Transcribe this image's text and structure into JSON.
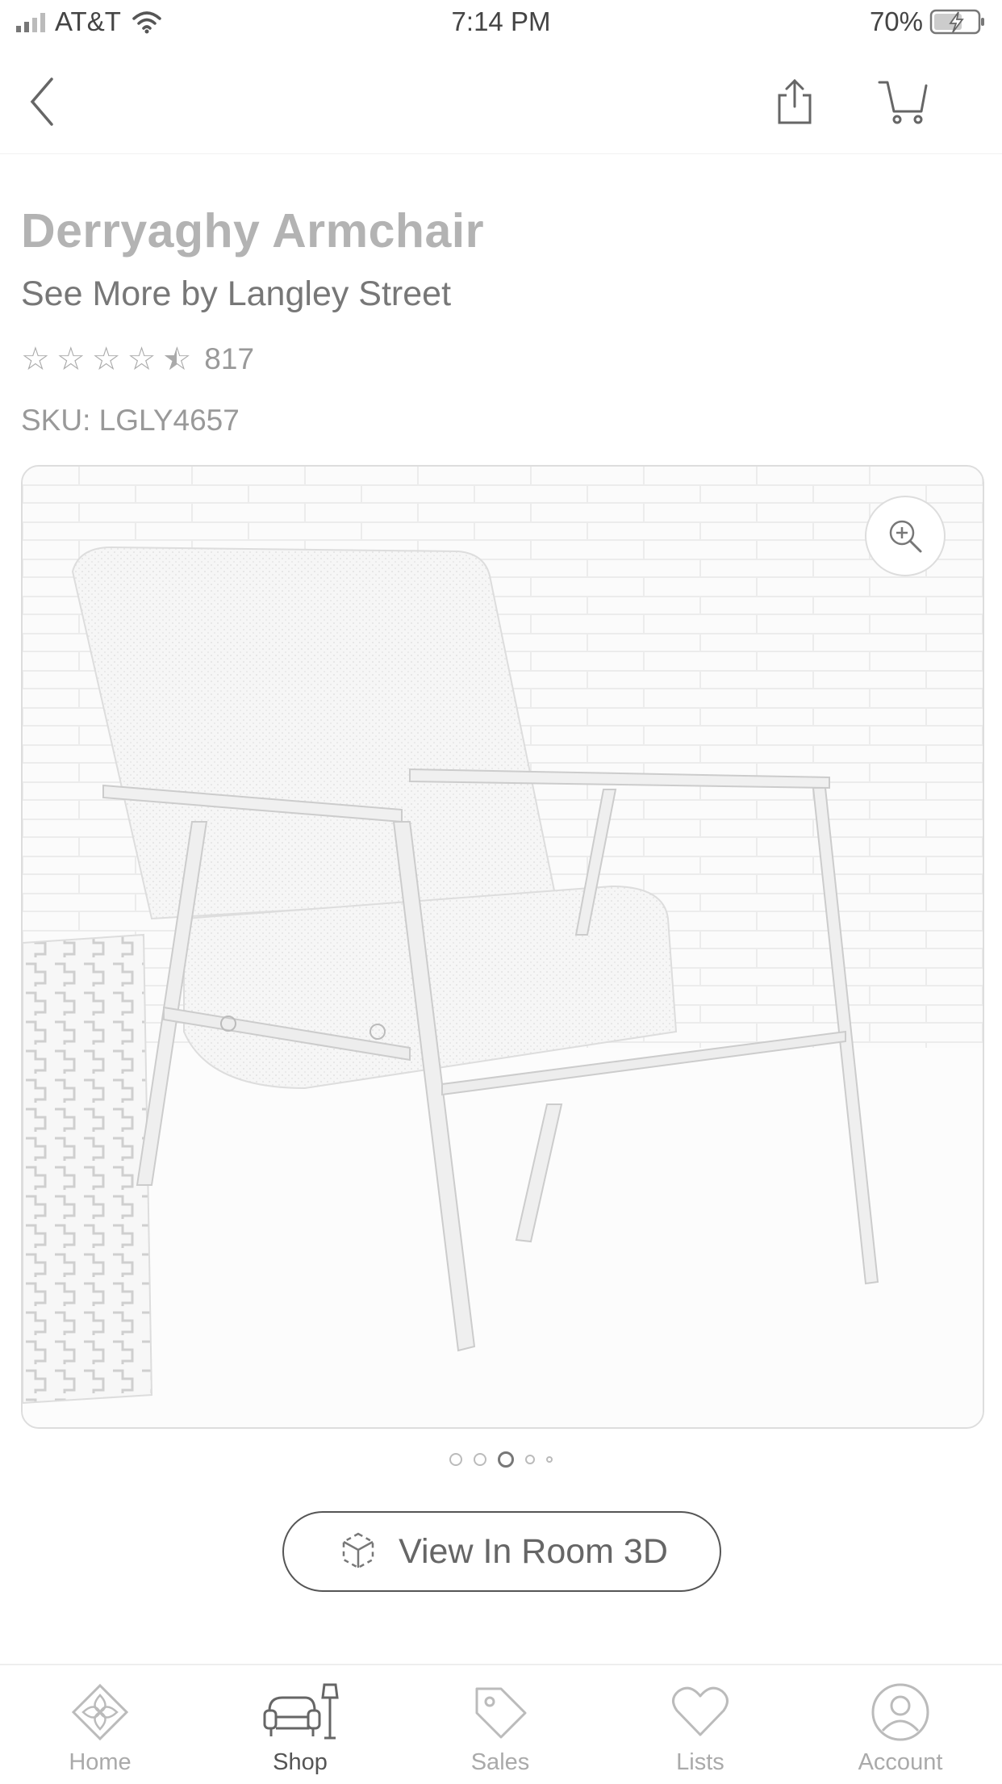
{
  "status_bar": {
    "carrier": "AT&T",
    "time": "7:14 PM",
    "battery": "70%"
  },
  "product": {
    "title": "Derryaghy Armchair",
    "brand_line": "See More by Langley Street",
    "rating": 4.5,
    "review_count": "817",
    "sku": "SKU: LGLY4657"
  },
  "gallery": {
    "dot_count": 5,
    "active_index": 2
  },
  "view3d": {
    "label": "View In Room 3D"
  },
  "tabs": [
    {
      "label": "Home",
      "icon": "home-icon",
      "active": false
    },
    {
      "label": "Shop",
      "icon": "armchair-lamp-icon",
      "active": true
    },
    {
      "label": "Sales",
      "icon": "tag-icon",
      "active": false
    },
    {
      "label": "Lists",
      "icon": "heart-icon",
      "active": false
    },
    {
      "label": "Account",
      "icon": "person-icon",
      "active": false
    }
  ],
  "colors": {
    "accent": "#555555",
    "muted": "#aaaaaa"
  }
}
